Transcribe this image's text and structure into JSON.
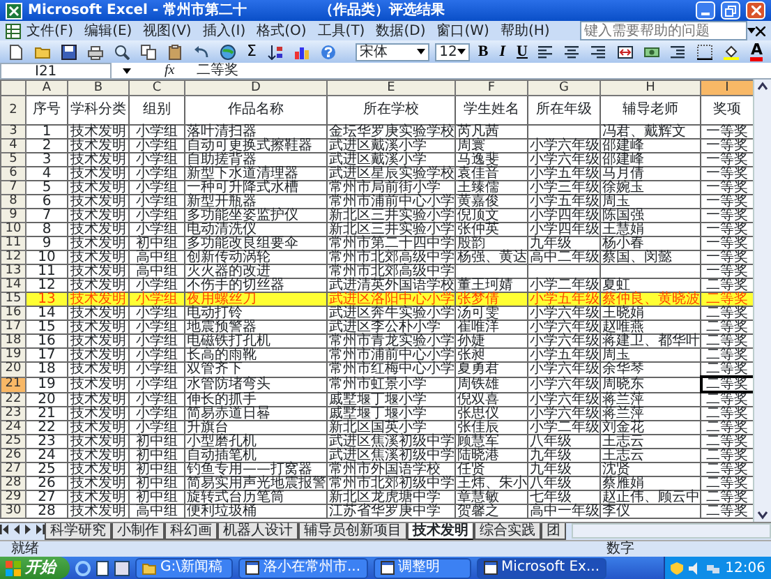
{
  "window": {
    "title_parts": [
      "Microsoft Excel - 常州市第二十",
      "（作品类）评选结果"
    ]
  },
  "menu": [
    "文件(F)",
    "编辑(E)",
    "视图(V)",
    "插入(I)",
    "格式(O)",
    "工具(T)",
    "数据(D)",
    "窗口(W)",
    "帮助(H)"
  ],
  "help_search": {
    "placeholder": "键入需要帮助的问题"
  },
  "toolbar": {
    "autosum": "Σ",
    "font": "宋体",
    "size": "12",
    "format_buttons": [
      "B",
      "I",
      "U"
    ],
    "font_color": "A"
  },
  "formula_bar": {
    "name_box": "I21",
    "fx": "fx",
    "value": "二等奖"
  },
  "sheet": {
    "columns": [
      {
        "label": "A",
        "selected": false
      },
      {
        "label": "B",
        "selected": false
      },
      {
        "label": "C",
        "selected": false
      },
      {
        "label": "D",
        "selected": false
      },
      {
        "label": "E",
        "selected": false
      },
      {
        "label": "F",
        "selected": false
      },
      {
        "label": "G",
        "selected": false
      },
      {
        "label": "H",
        "selected": false
      },
      {
        "label": "I",
        "selected": true
      }
    ],
    "header_row": {
      "row_number": "2",
      "cells": [
        "序号",
        "学科分类",
        "组别",
        "作品名称",
        "所在学校",
        "学生姓名",
        "所在年级",
        "辅导老师",
        "奖项"
      ]
    },
    "rows": [
      {
        "row_number": "3",
        "selected": false,
        "highlighted": false,
        "cells": [
          "1",
          "技术发明",
          "小学组",
          "落叶清扫器",
          "金坛华罗庚实验学校",
          "芮凡茜",
          "",
          "冯君、戴辉文",
          "一等奖"
        ]
      },
      {
        "row_number": "4",
        "selected": false,
        "highlighted": false,
        "cells": [
          "2",
          "技术发明",
          "小学组",
          "自动可更换式擦鞋器",
          "武进区戴溪小学",
          "周寰",
          "小学六年级",
          "邵建峰",
          "一等奖"
        ]
      },
      {
        "row_number": "5",
        "selected": false,
        "highlighted": false,
        "cells": [
          "3",
          "技术发明",
          "小学组",
          "自助搓背器",
          "武进区戴溪小学",
          "马逸斐",
          "小学六年级",
          "邵建峰",
          "一等奖"
        ]
      },
      {
        "row_number": "6",
        "selected": false,
        "highlighted": false,
        "cells": [
          "4",
          "技术发明",
          "小学组",
          "新型下水道清理器",
          "武进区星辰实验学校",
          "袁佳音",
          "小学五年级",
          "马月倩",
          "一等奖"
        ]
      },
      {
        "row_number": "7",
        "selected": false,
        "highlighted": false,
        "cells": [
          "5",
          "技术发明",
          "小学组",
          "一种可升降式水槽",
          "常州市局前街小学",
          "王臻儒",
          "小学三年级",
          "徐婉玉",
          "一等奖"
        ]
      },
      {
        "row_number": "8",
        "selected": false,
        "highlighted": false,
        "cells": [
          "6",
          "技术发明",
          "小学组",
          "新型开瓶器",
          "常州市浦前中心小学",
          "黄嘉俊",
          "小学五年级",
          "周玉",
          "一等奖"
        ]
      },
      {
        "row_number": "9",
        "selected": false,
        "highlighted": false,
        "cells": [
          "7",
          "技术发明",
          "小学组",
          "多功能坐姿监护仪",
          "新北区三井实验小学",
          "倪顶文",
          "小学四年级",
          "陈国强",
          "一等奖"
        ]
      },
      {
        "row_number": "10",
        "selected": false,
        "highlighted": false,
        "cells": [
          "8",
          "技术发明",
          "小学组",
          "电动清洗仪",
          "新北区三井实验小学",
          "张仲英",
          "小学四年级",
          "王慧娟",
          "一等奖"
        ]
      },
      {
        "row_number": "11",
        "selected": false,
        "highlighted": false,
        "cells": [
          "9",
          "技术发明",
          "初中组",
          "多功能改良组要伞",
          "常州市第二十四中学",
          "殷韵",
          "九年级",
          "杨小春",
          "一等奖"
        ]
      },
      {
        "row_number": "12",
        "selected": false,
        "highlighted": false,
        "cells": [
          "10",
          "技术发明",
          "高中组",
          "创新传动涡轮",
          "常州市北郊高级中学",
          "杨强、黄达",
          "高中二年级",
          "蔡国、闵懿",
          "一等奖"
        ]
      },
      {
        "row_number": "13",
        "selected": false,
        "highlighted": false,
        "cells": [
          "11",
          "技术发明",
          "高中组",
          "灭火器的改进",
          "常州市北郊高级中学",
          "",
          "",
          "",
          "一等奖"
        ]
      },
      {
        "row_number": "14",
        "selected": false,
        "highlighted": false,
        "cells": [
          "12",
          "技术发明",
          "小学组",
          "不伤手的切丝器",
          "武进清英外国语学校",
          "董王珂婧",
          "小学二年级",
          "夏虹",
          "二等奖"
        ]
      },
      {
        "row_number": "15",
        "selected": false,
        "highlighted": true,
        "cells": [
          "13",
          "技术发明",
          "小学组",
          "夜用螺丝刀",
          "武进区洛阳中心小学",
          "张梦倩",
          "小学五年级",
          "蔡仲良、黄晓波",
          "二等奖"
        ]
      },
      {
        "row_number": "16",
        "selected": false,
        "highlighted": false,
        "cells": [
          "14",
          "技术发明",
          "小学组",
          "电动打铃",
          "武进区奔牛实验小学",
          "汤可雯",
          "小学六年级",
          "王晓娟",
          "二等奖"
        ]
      },
      {
        "row_number": "17",
        "selected": false,
        "highlighted": false,
        "cells": [
          "15",
          "技术发明",
          "小学组",
          "地震预警器",
          "武进区李公朴小学",
          "崔唯洋",
          "小学六年级",
          "赵唯燕",
          "二等奖"
        ]
      },
      {
        "row_number": "18",
        "selected": false,
        "highlighted": false,
        "cells": [
          "16",
          "技术发明",
          "小学组",
          "电磁铁打孔机",
          "常州市青龙实验小学",
          "孙婕",
          "小学六年级",
          "蒋建卫、都华叶",
          "二等奖"
        ]
      },
      {
        "row_number": "19",
        "selected": false,
        "highlighted": false,
        "cells": [
          "17",
          "技术发明",
          "小学组",
          "长高的雨靴",
          "常州市浦前中心小学",
          "张昶",
          "小学五年级",
          "周玉",
          "二等奖"
        ]
      },
      {
        "row_number": "20",
        "selected": false,
        "highlighted": false,
        "cells": [
          "18",
          "技术发明",
          "小学组",
          "双管齐下",
          "常州市红梅中心小学",
          "夏勇君",
          "小学六年级",
          "余华琴",
          "二等奖"
        ]
      },
      {
        "row_number": "21",
        "selected": true,
        "highlighted": false,
        "cells": [
          "19",
          "技术发明",
          "小学组",
          "水管防堵弯头",
          "常州市虹景小学",
          "周铁雄",
          "小学六年级",
          "周晓东",
          "二等奖"
        ]
      },
      {
        "row_number": "22",
        "selected": false,
        "highlighted": false,
        "cells": [
          "20",
          "技术发明",
          "小学组",
          "伸长的抓手",
          "戚墅堰丁堰小学",
          "倪双喜",
          "小学六年级",
          "蒋兰萍",
          "二等奖"
        ]
      },
      {
        "row_number": "23",
        "selected": false,
        "highlighted": false,
        "cells": [
          "21",
          "技术发明",
          "小学组",
          "简易赤道日晷",
          "戚墅堰丁堰小学",
          "张思仪",
          "小学六年级",
          "蒋兰萍",
          "二等奖"
        ]
      },
      {
        "row_number": "24",
        "selected": false,
        "highlighted": false,
        "cells": [
          "22",
          "技术发明",
          "小学组",
          "升旗台",
          "新北区国英小学",
          "张佳辰",
          "小学二年级",
          "刘金花",
          "二等奖"
        ]
      },
      {
        "row_number": "25",
        "selected": false,
        "highlighted": false,
        "cells": [
          "23",
          "技术发明",
          "初中组",
          "小型磨孔机",
          "武进区焦溪初级中学",
          "顾慧军",
          "八年级",
          "王志云",
          "二等奖"
        ]
      },
      {
        "row_number": "26",
        "selected": false,
        "highlighted": false,
        "cells": [
          "24",
          "技术发明",
          "初中组",
          "自动插笔机",
          "武进区焦溪初级中学",
          "陆晓港",
          "九年级",
          "王志云",
          "二等奖"
        ]
      },
      {
        "row_number": "27",
        "selected": false,
        "highlighted": false,
        "cells": [
          "25",
          "技术发明",
          "初中组",
          "钓鱼专用——打窝器",
          "常州市外国语学校",
          "任贤",
          "九年级",
          "沈贤",
          "二等奖"
        ]
      },
      {
        "row_number": "28",
        "selected": false,
        "highlighted": false,
        "cells": [
          "26",
          "技术发明",
          "初中组",
          "简易实用声光地震报警",
          "常州市北郊初级中学",
          "王炜、朱小",
          "八年级",
          "蔡雁娟",
          "二等奖"
        ]
      },
      {
        "row_number": "29",
        "selected": false,
        "highlighted": false,
        "cells": [
          "27",
          "技术发明",
          "初中组",
          "旋转式台历笔筒",
          "新北区龙虎塘中学",
          "章慧敏",
          "七年级",
          "赵正伟、顾云中",
          "二等奖"
        ]
      },
      {
        "row_number": "30",
        "selected": false,
        "highlighted": false,
        "cells": [
          "28",
          "技术发明",
          "高中组",
          "便利垃圾桶",
          "江苏省华罗庚中学",
          "贺馨之",
          "高中一年级",
          "李仪",
          "二等奖"
        ]
      }
    ]
  },
  "sheet_tabs": [
    {
      "label": "科学研究",
      "selected": false
    },
    {
      "label": "小制作",
      "selected": false
    },
    {
      "label": "科幻画",
      "selected": false
    },
    {
      "label": "机器人设计",
      "selected": false
    },
    {
      "label": "辅导员创新项目",
      "selected": false
    },
    {
      "label": "技术发明",
      "selected": true
    },
    {
      "label": "综合实践",
      "selected": false
    },
    {
      "label": "团",
      "selected": false
    }
  ],
  "status_bar": {
    "left": "就绪",
    "right": "数字"
  },
  "taskbar": {
    "start": "开始",
    "items": [
      {
        "label": "G:\\新闻稿",
        "active": false
      },
      {
        "label": "洛小在常州市...",
        "active": false
      },
      {
        "label": "调整明",
        "active": false
      },
      {
        "label": "Microsoft Ex...",
        "active": true
      }
    ],
    "clock": "12:06"
  }
}
